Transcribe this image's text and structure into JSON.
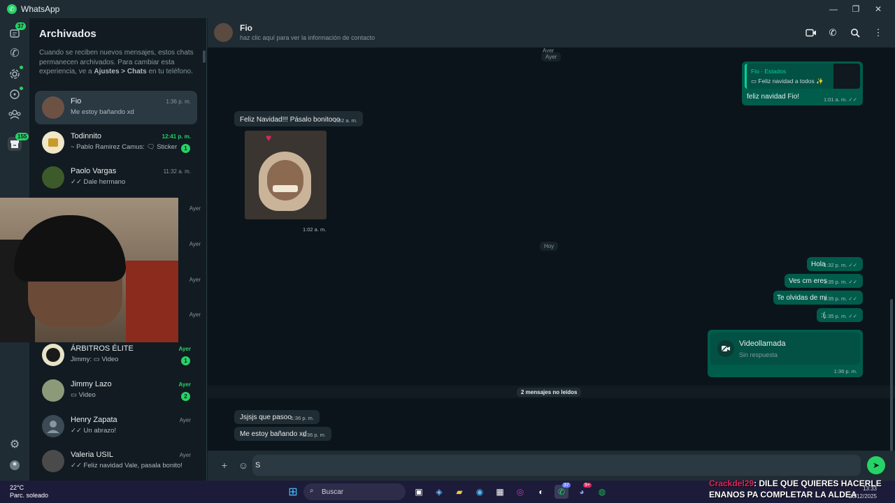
{
  "titlebar": {
    "app_name": "WhatsApp",
    "minimize": "—",
    "maximize": "❐",
    "close": "✕"
  },
  "rail": {
    "chats_badge": "37",
    "archived_badge": "155"
  },
  "panel": {
    "title": "Archivados",
    "info_part1": "Cuando se reciben nuevos mensajes, estos chats permanecen archivados. Para cambiar esta experiencia, ve a ",
    "info_bold": "Ajustes > Chats",
    "info_part2": " en tu teléfono.",
    "chats": [
      {
        "name": "Fio",
        "preview": "Me estoy bañando xd",
        "time": "1:36 p. m."
      },
      {
        "name": "Todinnito",
        "preview": "~ Pablo Ramirez Camus: 🗨 Sticker",
        "time": "12:41 p. m.",
        "unread": "1"
      },
      {
        "name": "Paolo Vargas",
        "preview": "✓✓ Dale hermano",
        "time": "11:32 a. m."
      },
      {
        "name": "ÁRBITROS ÉLITE",
        "preview": "Jimmy: ▭ Video",
        "time": "Ayer",
        "unread": "1"
      },
      {
        "name": "Jimmy Lazo",
        "preview": "▭ Video",
        "time": "Ayer",
        "unread": "2"
      },
      {
        "name": "Henry Zapata",
        "preview": "✓✓ Un abrazo!",
        "time": "Ayer"
      },
      {
        "name": "Valeria USIL",
        "preview": "✓✓ Feliz navidad Vale, pasala bonito!",
        "time": "Ayer"
      }
    ],
    "hidden_times": [
      "Ayer",
      "Ayer",
      "Ayer",
      "Ayer"
    ]
  },
  "header": {
    "name": "Fio",
    "subtitle": "haz clic aquí para ver la información de contacto"
  },
  "conversation": {
    "day_ayer_top": "Ayer",
    "day_ayer": "Ayer",
    "status_reply": {
      "label": "Fio · Estados",
      "quote": "▭ Feliz navidad a todos ✨",
      "text": "feliz navidad Fio!",
      "time": "1:01 a. m. ✓✓"
    },
    "msg_feliz": {
      "text": "Feliz Navidad!!! Pásalo bonitooo",
      "time": "1:02 a. m."
    },
    "sticker_time": "1:02 a. m.",
    "day_hoy": "Hoy",
    "out_msgs": [
      {
        "text": "Hola",
        "time": "1:32 p. m. ✓✓"
      },
      {
        "text": "Ves cm eres",
        "time": "1:35 p. m. ✓✓"
      },
      {
        "text": "Te olvidas de mi",
        "time": "1:35 p. m. ✓✓"
      },
      {
        "text": ":(",
        "time": "1:35 p. m. ✓✓"
      }
    ],
    "videocall": {
      "title": "Videollamada",
      "subtitle": "Sin respuesta",
      "time": "1:36 p. m."
    },
    "unread_divider": "2 mensajes no leídos",
    "in_msgs": [
      {
        "text": "Jsjsjs que pasoo",
        "time": "1:36 p. m."
      },
      {
        "text": "Me estoy bañando xd",
        "time": "1:36 p. m."
      }
    ]
  },
  "composer": {
    "value": "S"
  },
  "taskbar": {
    "weather_temp": "22°C",
    "weather_desc": "Parc. soleado",
    "search_label": "Buscar",
    "wa_badge": "37",
    "discord_badge": "9+",
    "chat_user": "Crackdel29",
    "chat_text": ": DILE QUE QUIERES HACERLE ENANOS PA COMPLETAR LA ALDEA",
    "lang": "ESP",
    "time": "13:33",
    "date": "26/12/2025"
  },
  "colors": {
    "accent": "#25d366",
    "outgoing": "#005c4b",
    "incoming": "#202c33"
  }
}
